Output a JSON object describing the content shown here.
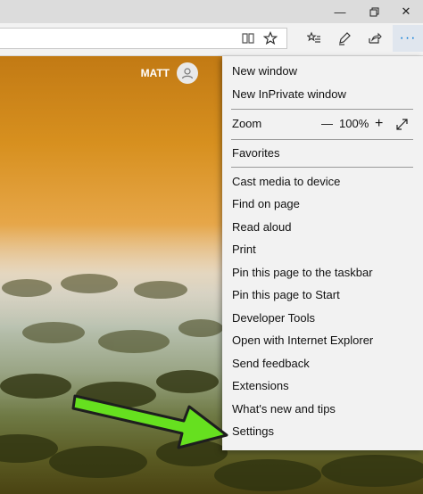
{
  "profile": {
    "name": "MATT"
  },
  "menu": {
    "group1": [
      "New window",
      "New InPrivate window"
    ],
    "zoom": {
      "label": "Zoom",
      "decrease": "—",
      "value": "100%",
      "increase": "+"
    },
    "favorites": "Favorites",
    "group2": [
      "Cast media to device",
      "Find on page",
      "Read aloud",
      "Print",
      "Pin this page to the taskbar",
      "Pin this page to Start",
      "Developer Tools",
      "Open with Internet Explorer",
      "Send feedback",
      "Extensions",
      "What's new and tips",
      "Settings"
    ]
  },
  "colors": {
    "accent": "#0078d7",
    "arrow": "#66e01f"
  },
  "icons": [
    "restore-icon",
    "minimize-icon",
    "close-icon",
    "reading-view-icon",
    "favorite-star-icon",
    "favorites-hub-icon",
    "web-note-icon",
    "share-icon",
    "more-icon",
    "user-icon",
    "fullscreen-icon"
  ]
}
